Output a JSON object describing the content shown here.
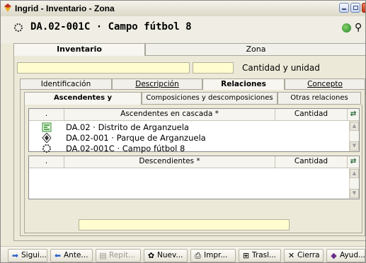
{
  "window": {
    "title": "Ingrid - Inventario - Zona"
  },
  "header": {
    "record_title": "DA.02-001C · Campo fútbol 8"
  },
  "main_tabs": [
    "Inventario",
    "Zona"
  ],
  "quantity_label": "Cantidad y unidad",
  "sub_tabs": [
    "Identificación",
    "Descripción",
    "Relaciones",
    "Concepto"
  ],
  "rel_tabs": [
    "Ascendentes y descendientes",
    "Composiciones y descomposiciones",
    "Otras relaciones"
  ],
  "ascendentes": {
    "columns": [
      ".",
      "Ascendentes en cascada *",
      "Cantidad"
    ],
    "rows": [
      {
        "icon": "district-icon",
        "label": "DA.02 · Distrito de Arganzuela"
      },
      {
        "icon": "park-icon",
        "label": "DA.02-001 · Parque de Arganzuela"
      },
      {
        "icon": "field-icon",
        "label": "DA.02-001C · Campo fútbol 8"
      }
    ]
  },
  "descendientes": {
    "columns": [
      ".",
      "Descendientes *",
      "Cantidad"
    ],
    "rows": []
  },
  "toolbar": {
    "buttons": [
      {
        "label": "Sigui...",
        "icon": "arrow-right-icon",
        "enabled": true
      },
      {
        "label": "Ante...",
        "icon": "arrow-left-icon",
        "enabled": true
      },
      {
        "label": "Repit...",
        "icon": "repeat-icon",
        "enabled": false
      },
      {
        "label": "Nuev...",
        "icon": "new-icon",
        "enabled": true
      },
      {
        "label": "Impr...",
        "icon": "print-icon",
        "enabled": true
      },
      {
        "label": "Trasl...",
        "icon": "transfer-icon",
        "enabled": true
      },
      {
        "label": "Cierra",
        "icon": "close-icon",
        "enabled": true
      },
      {
        "label": "Ayud...",
        "icon": "help-icon",
        "enabled": true
      }
    ]
  }
}
